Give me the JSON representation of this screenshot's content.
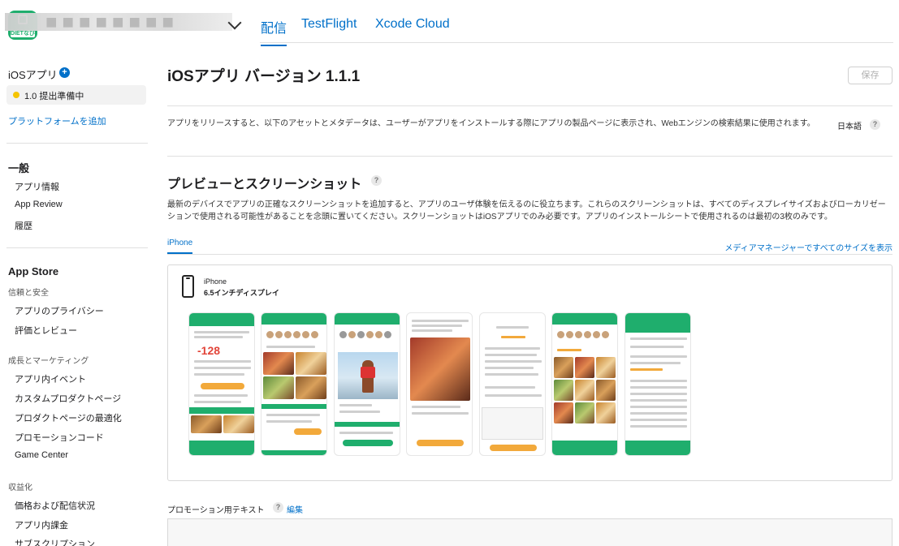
{
  "header": {
    "app_icon_badge": "DIETなび",
    "app_name_redacted": "■■■■■■■■",
    "tabs": [
      {
        "label": "配信",
        "active": true
      },
      {
        "label": "TestFlight",
        "active": false
      },
      {
        "label": "Xcode Cloud",
        "active": false
      }
    ]
  },
  "sidebar": {
    "platform_label": "iOSアプリ",
    "version_label": "1.0 提出準備中",
    "add_platform": "プラットフォームを追加",
    "general_heading": "一般",
    "general_items": [
      "アプリ情報",
      "App Review",
      "履歴"
    ],
    "appstore_heading": "App Store",
    "trust_heading": "信頼と安全",
    "trust_items": [
      "アプリのプライバシー",
      "評価とレビュー"
    ],
    "growth_heading": "成長とマーケティング",
    "growth_items": [
      "アプリ内イベント",
      "カスタムプロダクトページ",
      "プロダクトページの最適化",
      "プロモーションコード",
      "Game Center"
    ],
    "monetize_heading": "収益化",
    "monetize_items": [
      "価格および配信状況",
      "アプリ内課金",
      "サブスクリプション"
    ]
  },
  "main": {
    "title": "iOSアプリ バージョン 1.1.1",
    "save_label": "保存",
    "intro": "アプリをリリースすると、以下のアセットとメタデータは、ユーザーがアプリをインストールする際にアプリの製品ページに表示され、Webエンジンの検索結果に使用されます。",
    "language": "日本語",
    "preview_title": "プレビューとスクリーンショット",
    "preview_desc": "最新のデバイスでアプリの正確なスクリーンショットを追加すると、アプリのユーザ体験を伝えるのに役立ちます。これらのスクリーンショットは、すべてのディスプレイサイズおよびローカリゼーションで使用される可能性があることを念頭に置いてください。スクリーンショットはiOSアプリでのみ必要です。アプリのインストールシートで使用されるのは最初の3枚のみです。",
    "device_tab": "iPhone",
    "media_manager_link": "メディアマネージャーですべてのサイズを表示",
    "device_name": "iPhone",
    "device_size": "6.5インチディスプレイ",
    "screenshot_count": 7,
    "shot1_number": "-128",
    "promo_label": "プロモーション用テキスト",
    "promo_edit": "編集"
  }
}
